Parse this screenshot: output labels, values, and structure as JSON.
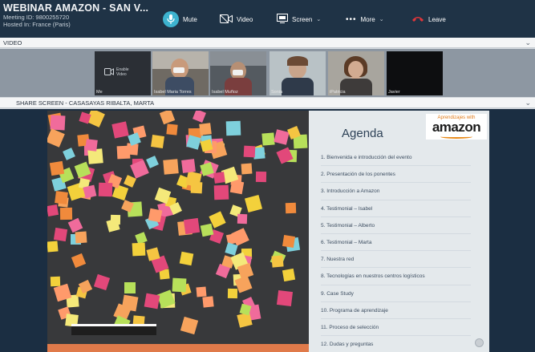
{
  "meeting": {
    "title": "WEBINAR AMAZON - SAN V...",
    "id_line": "Meeting ID: 9800255720",
    "host_line": "Hosted In: France (Paris)"
  },
  "controls": {
    "mute": "Mute",
    "video": "Video",
    "screen": "Screen",
    "more": "More",
    "leave": "Leave"
  },
  "video_bar": {
    "label": "VIDEO"
  },
  "video_tiles": [
    {
      "label": "Me",
      "line1": "Enable",
      "line2": "Video"
    },
    {
      "label": "Isabel Maria Torres"
    },
    {
      "label": "Isabel Muñoz"
    },
    {
      "label": "Sonia"
    },
    {
      "label": "iPatricia"
    },
    {
      "label": "Javier"
    }
  ],
  "share_bar": {
    "label": "SHARE SCREEN - CASASAYAS RIBALTA, MARTA"
  },
  "slide": {
    "title": "Agenda",
    "logo_top": "Aprendizajes with",
    "logo_word": "amazon",
    "items": [
      "1.   Bienvenida e introducción del evento",
      "2.   Presentación de los ponentes",
      "3.   Introducción a Amazon",
      "4.   Testimonial – Isabel",
      "5.   Testimonial – Alberto",
      "6.   Testimonial – Marta",
      "7.   Nuestra red",
      "8.   Tecnologías en nuestros centros logísticos",
      "9.   Case Study",
      "10.  Programa de aprendizaje",
      "11.  Proceso de selección",
      "12.  Dudas y preguntas"
    ]
  },
  "colors": {
    "topbar": "#1f3346",
    "mute_accent": "#3db3cf",
    "leave_red": "#e0353a",
    "share_bg": "#1b2e42",
    "amazon_orange": "#e88a1a"
  },
  "icons": [
    "mute-icon",
    "video-camera-icon",
    "screen-share-icon",
    "more-dots-icon",
    "leave-phone-icon",
    "chevron-down-icon"
  ]
}
